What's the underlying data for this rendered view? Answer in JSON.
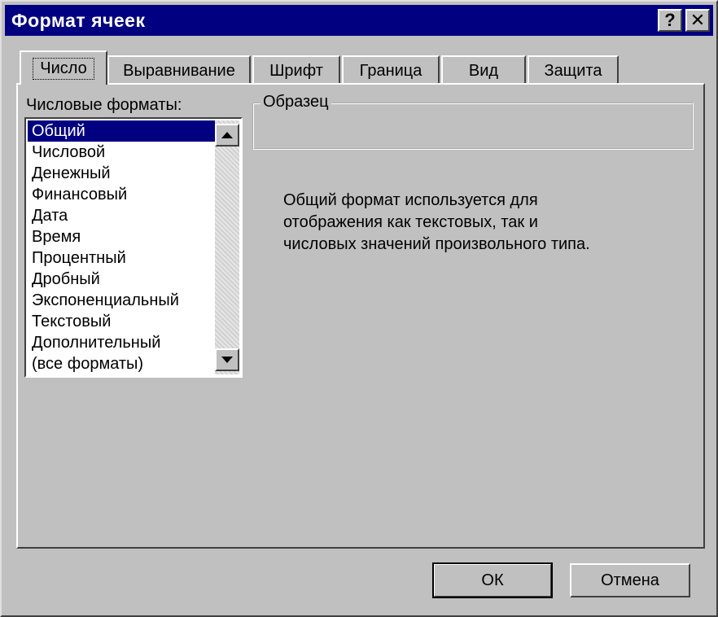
{
  "window": {
    "title": "Формат ячеек",
    "help_label": "?",
    "close_label": "✕"
  },
  "tabs": [
    {
      "label": "Число",
      "active": true
    },
    {
      "label": "Выравнивание",
      "active": false
    },
    {
      "label": "Шрифт",
      "active": false
    },
    {
      "label": "Граница",
      "active": false
    },
    {
      "label": "Вид",
      "active": false
    },
    {
      "label": "Защита",
      "active": false
    }
  ],
  "formats": {
    "label": "Числовые форматы:",
    "items": [
      "Общий",
      "Числовой",
      "Денежный",
      "Финансовый",
      "Дата",
      "Время",
      "Процентный",
      "Дробный",
      "Экспоненциальный",
      "Текстовый",
      "Дополнительный",
      "(все форматы)"
    ],
    "selected": "Общий"
  },
  "sample": {
    "legend": "Образец",
    "value": ""
  },
  "description": {
    "line1": "Общий формат используется для",
    "line2": "отображения как текстовых, так и",
    "line3": "числовых значений произвольного типа."
  },
  "buttons": {
    "ok": "ОК",
    "cancel": "Отмена"
  },
  "colors": {
    "face": "#c0c0c0",
    "title_bar": "#000080",
    "selection": "#000080"
  }
}
